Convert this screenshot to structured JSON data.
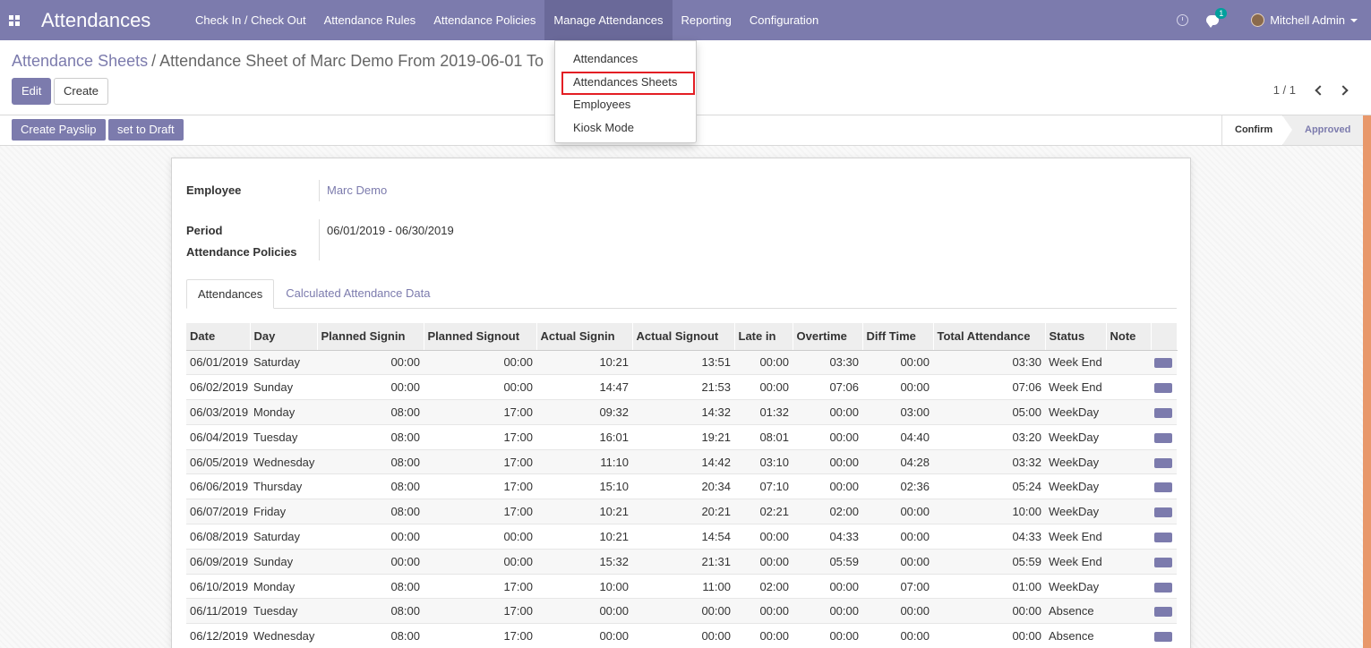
{
  "app": {
    "title": "Attendances"
  },
  "navbar": {
    "menu": [
      {
        "label": "Check In / Check Out"
      },
      {
        "label": "Attendance Rules"
      },
      {
        "label": "Attendance Policies"
      },
      {
        "label": "Manage Attendances"
      },
      {
        "label": "Reporting"
      },
      {
        "label": "Configuration"
      }
    ],
    "chat_badge": "1",
    "user_name": "Mitchell Admin"
  },
  "dropdown": {
    "items": [
      {
        "label": "Attendances"
      },
      {
        "label": "Attendances Sheets"
      },
      {
        "label": "Employees"
      },
      {
        "label": "Kiosk Mode"
      }
    ],
    "highlighted_color": "#e31e24"
  },
  "breadcrumb": {
    "parent": "Attendance Sheets",
    "separator": "/",
    "current": "Attendance Sheet of Marc Demo From 2019-06-01 To"
  },
  "buttons": {
    "edit": "Edit",
    "create": "Create",
    "create_payslip": "Create Payslip",
    "set_to_draft": "set to Draft"
  },
  "pager": {
    "value": "1 / 1"
  },
  "status": {
    "stages": [
      "Confirm",
      "Approved"
    ],
    "current": "Approved"
  },
  "form": {
    "employee_label": "Employee",
    "employee_value": "Marc Demo",
    "period_label": "Period",
    "period_value": "06/01/2019 - 06/30/2019",
    "policies_label": "Attendance Policies",
    "policies_value": ""
  },
  "tabs": [
    {
      "label": "Attendances",
      "active": true
    },
    {
      "label": "Calculated Attendance Data",
      "active": false
    }
  ],
  "table": {
    "columns": [
      "Date",
      "Day",
      "Planned Signin",
      "Planned Signout",
      "Actual Signin",
      "Actual Signout",
      "Late in",
      "Overtime",
      "Diff Time",
      "Total Attendance",
      "Status",
      "Note"
    ],
    "rows": [
      [
        "06/01/2019",
        "Saturday",
        "00:00",
        "00:00",
        "10:21",
        "13:51",
        "00:00",
        "03:30",
        "00:00",
        "03:30",
        "Week End"
      ],
      [
        "06/02/2019",
        "Sunday",
        "00:00",
        "00:00",
        "14:47",
        "21:53",
        "00:00",
        "07:06",
        "00:00",
        "07:06",
        "Week End"
      ],
      [
        "06/03/2019",
        "Monday",
        "08:00",
        "17:00",
        "09:32",
        "14:32",
        "01:32",
        "00:00",
        "03:00",
        "05:00",
        "WeekDay"
      ],
      [
        "06/04/2019",
        "Tuesday",
        "08:00",
        "17:00",
        "16:01",
        "19:21",
        "08:01",
        "00:00",
        "04:40",
        "03:20",
        "WeekDay"
      ],
      [
        "06/05/2019",
        "Wednesday",
        "08:00",
        "17:00",
        "11:10",
        "14:42",
        "03:10",
        "00:00",
        "04:28",
        "03:32",
        "WeekDay"
      ],
      [
        "06/06/2019",
        "Thursday",
        "08:00",
        "17:00",
        "15:10",
        "20:34",
        "07:10",
        "00:00",
        "02:36",
        "05:24",
        "WeekDay"
      ],
      [
        "06/07/2019",
        "Friday",
        "08:00",
        "17:00",
        "10:21",
        "20:21",
        "02:21",
        "02:00",
        "00:00",
        "10:00",
        "WeekDay"
      ],
      [
        "06/08/2019",
        "Saturday",
        "00:00",
        "00:00",
        "10:21",
        "14:54",
        "00:00",
        "04:33",
        "00:00",
        "04:33",
        "Week End"
      ],
      [
        "06/09/2019",
        "Sunday",
        "00:00",
        "00:00",
        "15:32",
        "21:31",
        "00:00",
        "05:59",
        "00:00",
        "05:59",
        "Week End"
      ],
      [
        "06/10/2019",
        "Monday",
        "08:00",
        "17:00",
        "10:00",
        "11:00",
        "02:00",
        "00:00",
        "07:00",
        "01:00",
        "WeekDay"
      ],
      [
        "06/11/2019",
        "Tuesday",
        "08:00",
        "17:00",
        "00:00",
        "00:00",
        "00:00",
        "00:00",
        "00:00",
        "00:00",
        "Absence"
      ],
      [
        "06/12/2019",
        "Wednesday",
        "08:00",
        "17:00",
        "00:00",
        "00:00",
        "00:00",
        "00:00",
        "00:00",
        "00:00",
        "Absence"
      ]
    ]
  },
  "colors": {
    "brand": "#7c7bad",
    "highlight": "#e31e24"
  }
}
